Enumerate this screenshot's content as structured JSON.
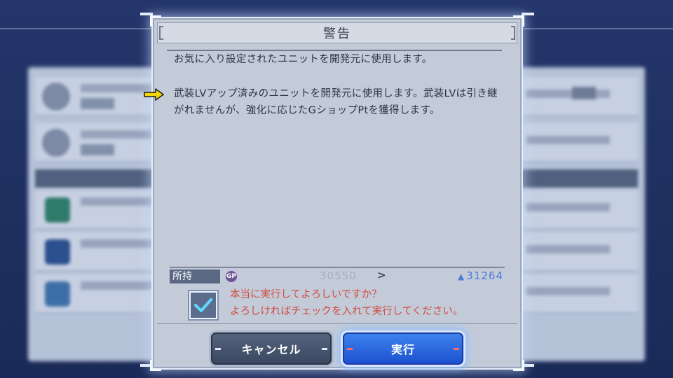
{
  "dialog": {
    "title": "警告",
    "message_line1": "お気に入り設定されたユニットを開発元に使用します。",
    "message_warning": "武装LVアップ済みのユニットを開発元に使用します。武装LVは引き継がれませんが、強化に応じたGショップPtを獲得します。",
    "owned": {
      "label": "所持",
      "currency_icon": "gp-coin-icon",
      "currency_glyph": "GP",
      "current_value": "30550",
      "arrow": ">",
      "up_glyph": "▲",
      "new_value": "31264"
    },
    "confirm": {
      "checked": true,
      "line1": "本当に実行してよろしいですか？",
      "line2": "よろしければチェックを入れて実行してください。"
    },
    "buttons": {
      "cancel": "キャンセル",
      "execute": "実行"
    }
  },
  "annotation": {
    "pointer_icon": "yellow-arrow-icon",
    "pointer_color": "#f5d800"
  },
  "colors": {
    "warning_text": "#d24b3e",
    "accent_blue": "#1c4fcf",
    "positive_value": "#4d7cd6"
  }
}
